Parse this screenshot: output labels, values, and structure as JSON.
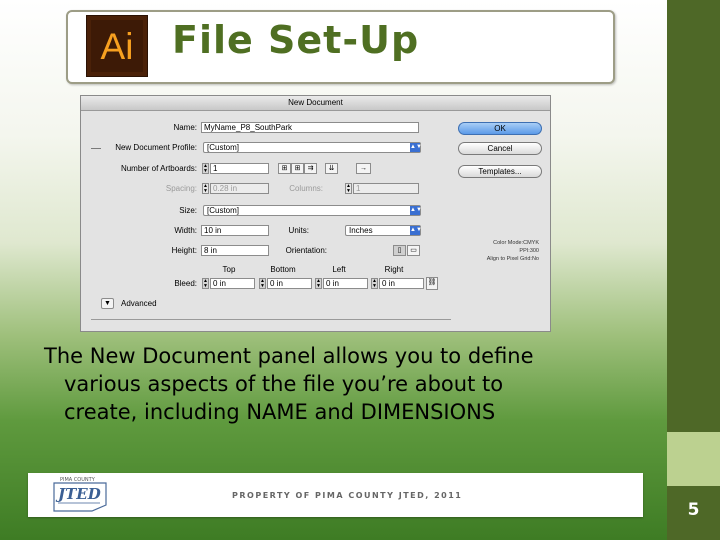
{
  "slide": {
    "title": "File Set-Up",
    "logo_text": "Ai",
    "caption_line1": "The New Document panel allows you to define",
    "caption_line2": "various aspects of the file you’re about to",
    "caption_line3": "create, including NAME and DIMENSIONS",
    "footer_text": "PROPERTY OF PIMA COUNTY JTED, 2011",
    "footer_logo_text": "JTED",
    "footer_logo_top": "PIMA COUNTY",
    "page_number": "5",
    "colors": {
      "title_green": "#4f6f22",
      "sidebar_green": "#4e6827",
      "logo_orange": "#f7a020"
    }
  },
  "dialog": {
    "title": "New Document",
    "name_label": "Name:",
    "name_value": "MyName_P8_SouthPark",
    "profile_label": "New Document Profile:",
    "profile_value": "[Custom]",
    "artboards_label": "Number of Artboards:",
    "artboards_value": "1",
    "spacing_label": "Spacing:",
    "spacing_value": "0.28 in",
    "columns_label": "Columns:",
    "columns_value": "1",
    "size_label": "Size:",
    "size_value": "[Custom]",
    "width_label": "Width:",
    "width_value": "10 in",
    "units_label": "Units:",
    "units_value": "Inches",
    "height_label": "Height:",
    "height_value": "8 in",
    "orientation_label": "Orientation:",
    "bleed_label": "Bleed:",
    "bleed_top_label": "Top",
    "bleed_bottom_label": "Bottom",
    "bleed_left_label": "Left",
    "bleed_right_label": "Right",
    "bleed_top": "0 in",
    "bleed_bottom": "0 in",
    "bleed_left": "0 in",
    "bleed_right": "0 in",
    "advanced_label": "Advanced",
    "ok_label": "OK",
    "cancel_label": "Cancel",
    "templates_label": "Templates...",
    "info_color_mode": "Color Mode:CMYK",
    "info_ppi": "PPI:300",
    "info_align": "Align to Pixel Grid:No"
  }
}
